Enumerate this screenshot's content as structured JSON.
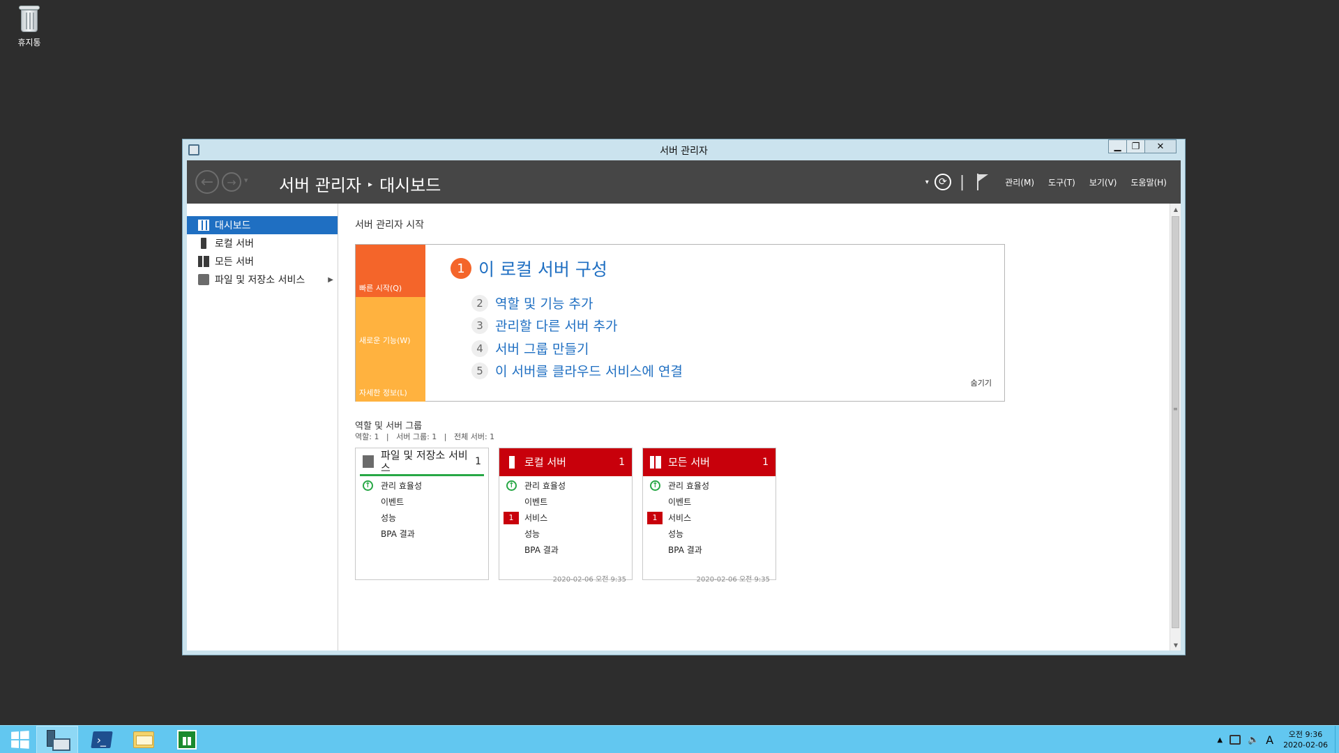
{
  "desktop": {
    "recycle_bin_label": "휴지통"
  },
  "window": {
    "title": "서버 관리자",
    "minimize": "▁",
    "maximize": "❐",
    "close": "✕"
  },
  "header": {
    "breadcrumb_root": "서버 관리자",
    "breadcrumb_separator": "▸",
    "breadcrumb_current": "대시보드",
    "menus": [
      "관리(M)",
      "도구(T)",
      "보기(V)",
      "도움말(H)"
    ],
    "nav_dropdown": "▾",
    "refresh_glyph": "⟳",
    "divider": "|"
  },
  "sidebar": {
    "items": [
      {
        "label": "대시보드",
        "icon": "dashboard-icon",
        "active": true
      },
      {
        "label": "로컬 서버",
        "icon": "server-icon"
      },
      {
        "label": "모든 서버",
        "icon": "servers-icon"
      },
      {
        "label": "파일 및 저장소 서비스",
        "icon": "file-storage-icon",
        "arrow": "▶"
      }
    ]
  },
  "main": {
    "title": "서버 관리자 시작",
    "tiles": [
      "빠른 시작(Q)",
      "새로운 기능(W)",
      "자세한 정보(L)"
    ],
    "step1": {
      "num": "1",
      "label": "이 로컬 서버 구성"
    },
    "steps": [
      {
        "num": "2",
        "label": "역할 및 기능 추가"
      },
      {
        "num": "3",
        "label": "관리할 다른 서버 추가"
      },
      {
        "num": "4",
        "label": "서버 그룹 만들기"
      },
      {
        "num": "5",
        "label": "이 서버를 클라우드 서비스에 연결"
      }
    ],
    "hide_label": "숨기기",
    "roles_title": "역할 및 서버 그룹",
    "roles_summary": "역할: 1   |   서버 그룹: 1   |   전체 서버: 1"
  },
  "cards": [
    {
      "name": "파일 및 저장소 서비스",
      "count": "1",
      "rows": [
        {
          "label": "관리 효율성",
          "status": "ok"
        },
        {
          "label": "이벤트"
        },
        {
          "label": "성능"
        },
        {
          "label": "BPA 결과"
        }
      ],
      "stamp": ""
    },
    {
      "name": "로컬 서버",
      "count": "1",
      "rows": [
        {
          "label": "관리 효율성",
          "status": "ok"
        },
        {
          "label": "이벤트"
        },
        {
          "label": "서비스",
          "badge": "1"
        },
        {
          "label": "성능"
        },
        {
          "label": "BPA 결과"
        }
      ],
      "stamp": "2020-02-06 오전 9:35"
    },
    {
      "name": "모든 서버",
      "count": "1",
      "rows": [
        {
          "label": "관리 효율성",
          "status": "ok"
        },
        {
          "label": "이벤트"
        },
        {
          "label": "서비스",
          "badge": "1"
        },
        {
          "label": "성능"
        },
        {
          "label": "BPA 결과"
        }
      ],
      "stamp": "2020-02-06 오전 9:35"
    }
  ],
  "taskbar": {
    "apps": [
      "server-manager-icon",
      "powershell-icon",
      "file-explorer-icon",
      "store-icon"
    ],
    "tray_ime": "A",
    "clock_time": "오전 9:36",
    "clock_date": "2020-02-06"
  },
  "colors": {
    "accent_blue": "#1f6fc2",
    "quickstart_orange": "#f4652a",
    "tile_amber": "#ffb23f",
    "alert_red": "#c8000b",
    "ok_green": "#27a745",
    "taskbar": "#62c7f0"
  }
}
